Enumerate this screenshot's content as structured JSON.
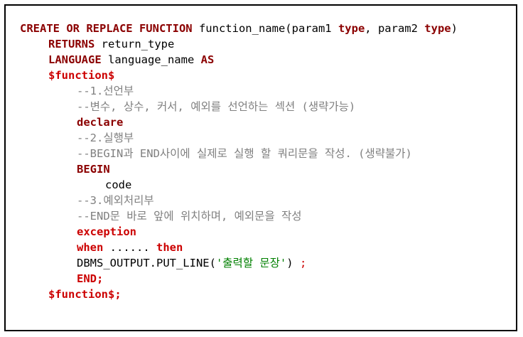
{
  "code": {
    "l1": {
      "kw": "CREATE OR REPLACE FUNCTION",
      "name": " function_name(param1 ",
      "type1": "type",
      "sep": ", param2 ",
      "type2": "type",
      "close": ")"
    },
    "l2": {
      "kw": "RETURNS",
      "rest": " return_type"
    },
    "l3": {
      "kw": "LANGUAGE",
      "rest": " language_name ",
      "kw2": "AS"
    },
    "l4": {
      "kw": "$function$"
    },
    "l5": {
      "comment": "--1.선언부"
    },
    "l6": {
      "comment": "--변수, 상수, 커서, 예외를 선언하는 섹션 (생략가능)"
    },
    "l7": {
      "kw": "declare"
    },
    "l8": {
      "comment": "--2.실행부"
    },
    "l9": {
      "comment": "--BEGIN과 END사이에 실제로 실행 할 쿼리문을 작성. (생략불가)"
    },
    "l10": {
      "kw": "BEGIN"
    },
    "l11": {
      "text": "code"
    },
    "l12": {
      "comment": "--3.예외처리부"
    },
    "l13": {
      "comment": "--END문 바로 앞에 위치하며, 예외문을 작성"
    },
    "l14": {
      "kw": "exception"
    },
    "l15": {
      "kw": "when",
      "dots": " ...... ",
      "kw2": "then"
    },
    "l16": {
      "fn": "DBMS_OUTPUT.PUT_LINE(",
      "str": "'출력할 문장'",
      "close": ") ",
      "semi": ";"
    },
    "l17": {
      "kw": "END;"
    },
    "l18": {
      "kw": "$function$;"
    }
  },
  "colors": {
    "keyword_dark": "#8b0000",
    "keyword_red": "#cc0000",
    "comment": "#808080",
    "string": "#008000",
    "border": "#000000"
  }
}
